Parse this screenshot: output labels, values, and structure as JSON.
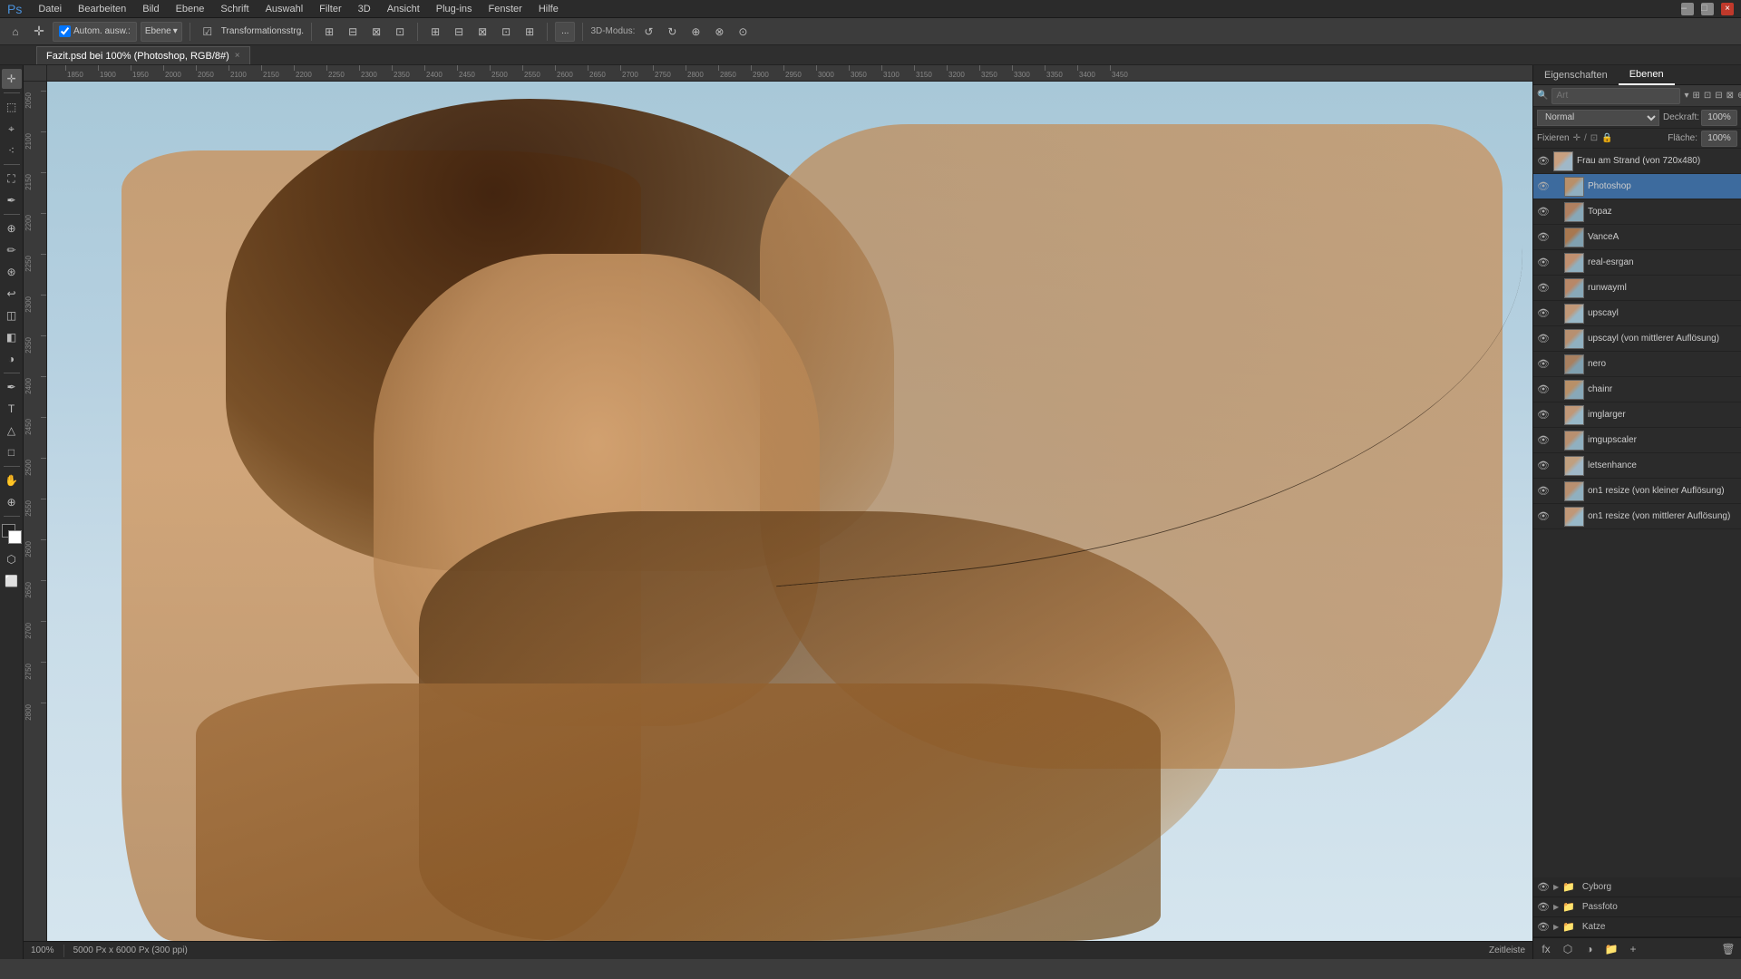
{
  "app": {
    "title": "Adobe Photoshop"
  },
  "menu": {
    "items": [
      "Datei",
      "Bearbeiten",
      "Bild",
      "Ebene",
      "Schrift",
      "Auswahl",
      "Filter",
      "3D",
      "Ansicht",
      "Plug-ins",
      "Fenster",
      "Hilfe"
    ]
  },
  "toolbar": {
    "autoselect_label": "Autom. ausw.:",
    "autoselect_value": "Ebene",
    "transform_label": "Transformationsstrg.",
    "mode_3d": "3D-Modus:",
    "more_label": "..."
  },
  "tab": {
    "filename": "Fazit.psd bei 100% (Photoshop, RGB/8#)",
    "close": "×"
  },
  "canvas": {
    "zoom": "100%",
    "dimensions": "5000 Px x 6000 Px (300 ppi)"
  },
  "status_bar": {
    "zoom": "100%",
    "dimensions": "5000 Px x 6000 Px (300 ppi)",
    "label": "Zeitleiste"
  },
  "panels": {
    "eigenschaften": "Eigenschaften",
    "ebenen": "Ebenen"
  },
  "layers_panel": {
    "search_placeholder": "Art",
    "blend_mode": "Normal",
    "opacity_label": "Deckraft:",
    "opacity_value": "100%",
    "filter_label": "Fixieren",
    "fläche_label": "Fläche:",
    "fläche_value": "100%",
    "layers": [
      {
        "name": "Frau am Strand (von 720x480)",
        "thumb_class": "thumb-frau",
        "visible": true,
        "selected": false,
        "indent": 0
      },
      {
        "name": "Photoshop",
        "thumb_class": "thumb-photoshop",
        "visible": true,
        "selected": true,
        "indent": 1
      },
      {
        "name": "Topaz",
        "thumb_class": "thumb-topaz",
        "visible": true,
        "selected": false,
        "indent": 1
      },
      {
        "name": "VanceA",
        "thumb_class": "thumb-vancea",
        "visible": true,
        "selected": false,
        "indent": 1
      },
      {
        "name": "real-esrgan",
        "thumb_class": "thumb-real",
        "visible": true,
        "selected": false,
        "indent": 1
      },
      {
        "name": "runwayml",
        "thumb_class": "thumb-runway",
        "visible": true,
        "selected": false,
        "indent": 1
      },
      {
        "name": "upscayl",
        "thumb_class": "thumb-upscayl",
        "visible": true,
        "selected": false,
        "indent": 1
      },
      {
        "name": "upscayl (von mittlerer Auflösung)",
        "thumb_class": "thumb-upscayl2",
        "visible": true,
        "selected": false,
        "indent": 1
      },
      {
        "name": "nero",
        "thumb_class": "thumb-nero",
        "visible": true,
        "selected": false,
        "indent": 1
      },
      {
        "name": "chainr",
        "thumb_class": "thumb-chainr",
        "visible": true,
        "selected": false,
        "indent": 1
      },
      {
        "name": "imglarger",
        "thumb_class": "thumb-imglarger",
        "visible": true,
        "selected": false,
        "indent": 1
      },
      {
        "name": "imgupscaler",
        "thumb_class": "thumb-imgupscaler",
        "visible": true,
        "selected": false,
        "indent": 1
      },
      {
        "name": "letsenhance",
        "thumb_class": "thumb-lets",
        "visible": true,
        "selected": false,
        "indent": 1
      },
      {
        "name": "on1 resize (von kleiner Auflösung)",
        "thumb_class": "thumb-on1",
        "visible": true,
        "selected": false,
        "indent": 1
      },
      {
        "name": "on1 resize (von mittlerer Auflösung)",
        "thumb_class": "thumb-on12",
        "visible": true,
        "selected": false,
        "indent": 1
      }
    ],
    "groups": [
      {
        "name": "Cyborg",
        "expanded": false
      },
      {
        "name": "Passfoto",
        "expanded": false
      },
      {
        "name": "Katze",
        "expanded": false
      }
    ]
  },
  "ruler": {
    "h_labels": [
      "1850",
      "1900",
      "1950",
      "2000",
      "2050",
      "2100",
      "2150",
      "2200",
      "2250",
      "2300",
      "2350",
      "2400",
      "2450",
      "2500",
      "2550",
      "2600",
      "2650",
      "2700",
      "2750",
      "2800",
      "2850",
      "2900",
      "2950",
      "3000",
      "3050",
      "3100",
      "3150",
      "3200",
      "3250",
      "3300",
      "3350",
      "3400",
      "3450"
    ],
    "v_labels": [
      "2050",
      "2100",
      "2150",
      "2200",
      "2250",
      "2300",
      "2350",
      "2400",
      "2450",
      "2500",
      "2550",
      "2600",
      "2650",
      "2700",
      "2750",
      "2800"
    ]
  }
}
